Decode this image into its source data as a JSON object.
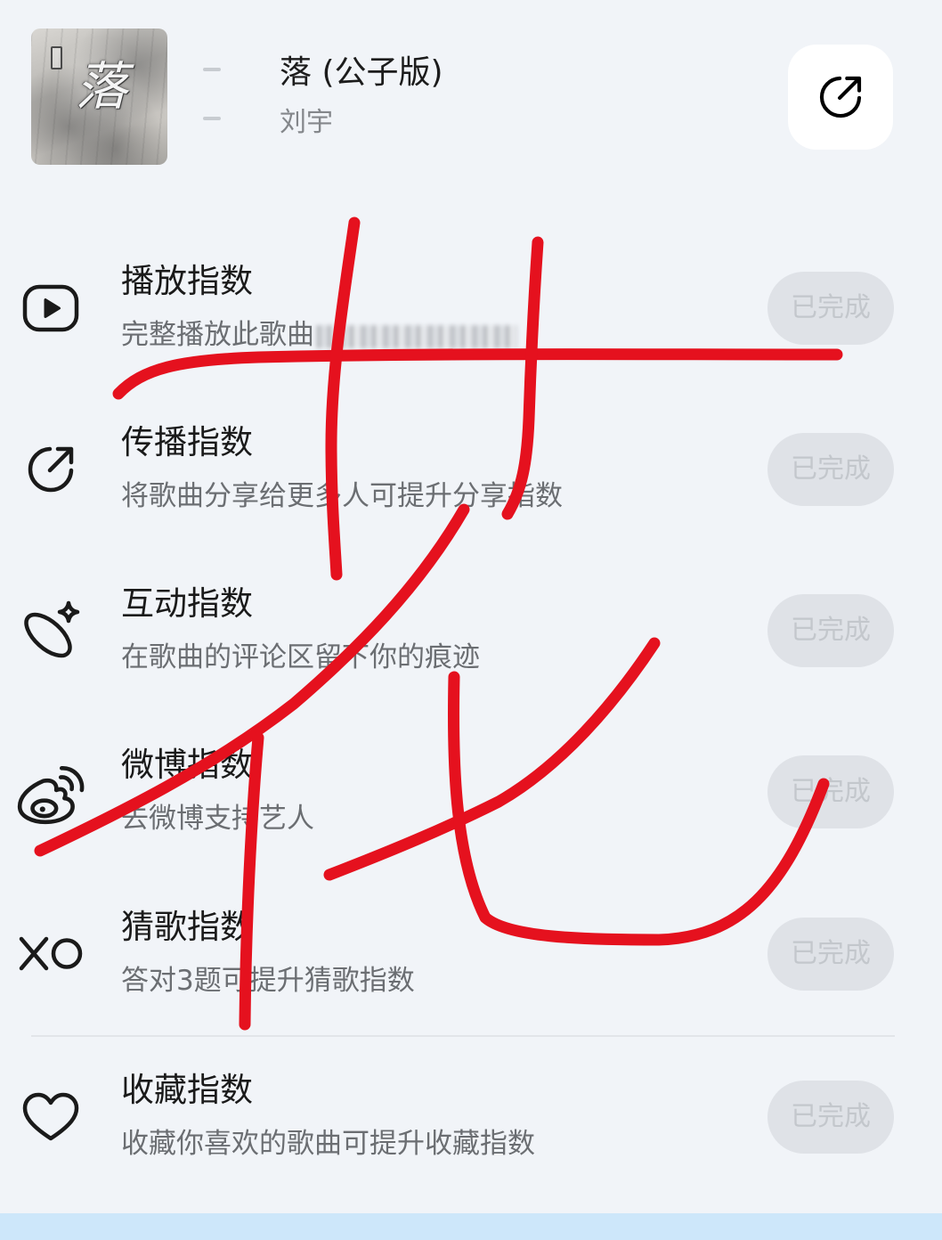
{
  "song": {
    "cover_text": "落",
    "title": "落 (公子版)",
    "artist": "刘宇"
  },
  "share": {
    "icon": "share-icon"
  },
  "tasks": [
    {
      "icon": "play-icon",
      "title": "播放指数",
      "desc": "完整播放此歌曲",
      "desc_blurred": true,
      "button": "已完成"
    },
    {
      "icon": "share-icon",
      "title": "传播指数",
      "desc": "将歌曲分享给更多人可提升分享指数",
      "button": "已完成"
    },
    {
      "icon": "sparkle-orbit-icon",
      "title": "互动指数",
      "desc": "在歌曲的评论区留下你的痕迹",
      "button": "已完成"
    },
    {
      "icon": "weibo-icon",
      "title": "微博指数",
      "desc": "去微博支持艺人",
      "button": "已完成"
    },
    {
      "icon": "xo-icon",
      "title": "猜歌指数",
      "desc": "答对3题可提升猜歌指数",
      "button": "已完成"
    },
    {
      "icon": "heart-icon",
      "title": "收藏指数",
      "desc": "收藏你喜欢的歌曲可提升收藏指数",
      "button": "已完成"
    }
  ],
  "colors": {
    "background": "#f1f4f8",
    "button_bg": "#dfe2e7",
    "button_text": "#c3c7cc",
    "bottom_bar": "#cde7fa",
    "handwriting": "#e5111e"
  }
}
